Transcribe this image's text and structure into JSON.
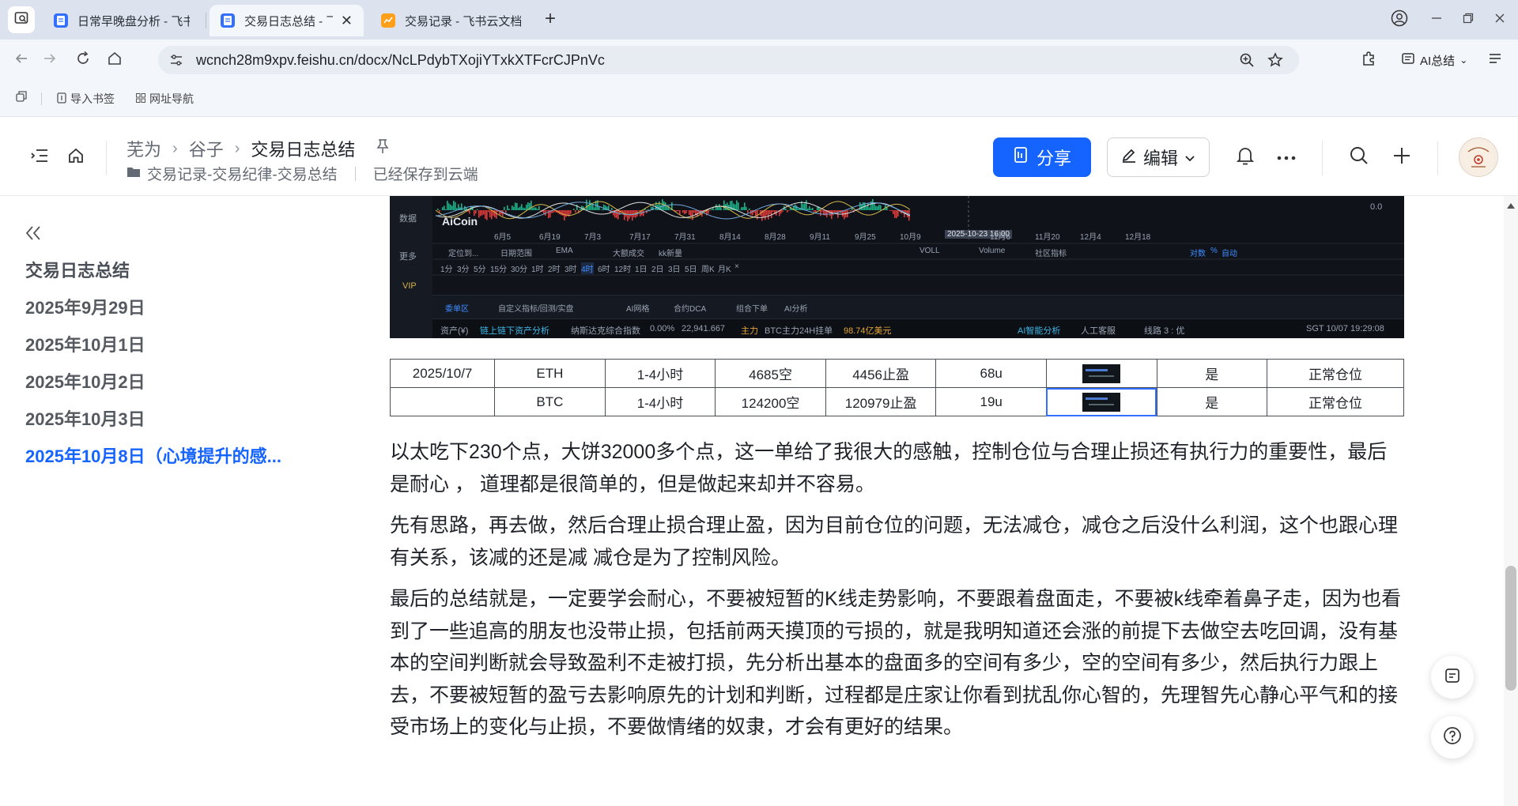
{
  "browser": {
    "tabs": [
      {
        "label": "日常早晚盘分析 - 飞书",
        "active": false
      },
      {
        "label": "交易日志总结 - 飞",
        "active": true
      },
      {
        "label": "交易记录 - 飞书云文档",
        "active": false
      }
    ],
    "url": "wcnch28m9xpv.feishu.cn/docx/NcLPdybTXojiYTxkXTFcrCJPnVc",
    "ai_label": "AI总结",
    "bookmarks": [
      "导入书签",
      "网址导航"
    ]
  },
  "header": {
    "breadcrumb": [
      "芜为",
      "谷子",
      "交易日志总结"
    ],
    "folder": "交易记录-交易纪律-交易总结",
    "save_status": "已经保存到云端",
    "share_label": "分享",
    "edit_label": "编辑"
  },
  "outline": {
    "items": [
      {
        "label": "交易日志总结",
        "active": false
      },
      {
        "label": "2025年9月29日",
        "active": false
      },
      {
        "label": "2025年10月1日",
        "active": false
      },
      {
        "label": "2025年10月2日",
        "active": false
      },
      {
        "label": "2025年10月3日",
        "active": false
      },
      {
        "label": "2025年10月8日（心境提升的感...",
        "active": true
      }
    ]
  },
  "chart_image": {
    "brand": "AiCoin",
    "x_ticks": [
      "6月5",
      "6月19",
      "7月3",
      "7月17",
      "7月31",
      "8月14",
      "8月28",
      "9月11",
      "9月25",
      "10月9",
      "2025-10-23 16:00",
      "11月6",
      "11月20",
      "12月4",
      "12月18"
    ],
    "toolbar": [
      "定位到...",
      "日期范围",
      "EMA",
      "大额成交",
      "kk新量",
      "VOLL",
      "Volume",
      "社区指标",
      "对数",
      "%",
      "自动"
    ],
    "intervals": [
      "1分",
      "3分",
      "5分",
      "15分",
      "30分",
      "1时",
      "2时",
      "3时",
      "4时",
      "6时",
      "12时",
      "1日",
      "2日",
      "3日",
      "5日",
      "周K",
      "月K",
      "×"
    ],
    "tabs": [
      "委单区",
      "自定义指标/回测/实盘",
      "AI网格",
      "合约DCA",
      "组合下单",
      "AI分析"
    ],
    "status": {
      "asset": "资产(¥)",
      "analysis": "链上链下资产分析",
      "nasdaq": "纳斯达克综合指数",
      "pct": "0.00%",
      "value": "22,941.667",
      "main": "主力",
      "btc_order": "BTC主力24H挂单",
      "btc_amount": "98.74亿美元",
      "ai": "AI智能分析",
      "service": "人工客服",
      "line": "线路 3 : 优",
      "time": "SGT 10/07 19:29:08"
    },
    "side_labels": [
      "数据",
      "更多",
      "VIP"
    ],
    "right_value": "0.0"
  },
  "trade_table": {
    "rows": [
      [
        "2025/10/7",
        "ETH",
        "1-4小时",
        "4685空",
        "4456止盈",
        "68u",
        "",
        "是",
        "正常仓位"
      ],
      [
        "",
        "BTC",
        "1-4小时",
        "124200空",
        "120979止盈",
        "19u",
        "",
        "是",
        "正常仓位"
      ]
    ]
  },
  "paragraphs": [
    "以太吃下230个点，大饼32000多个点，这一单给了我很大的感触，控制仓位与合理止损还有执行力的重要性，最后是耐心 ， 道理都是很简单的，但是做起来却并不容易。",
    "先有思路，再去做，然后合理止损合理止盈，因为目前仓位的问题，无法减仓，减仓之后没什么利润，这个也跟心理有关系，该减的还是减 减仓是为了控制风险。",
    "最后的总结就是，一定要学会耐心，不要被短暂的K线走势影响，不要跟着盘面走，不要被k线牵着鼻子走，因为也看到了一些追高的朋友也没带止损，包括前两天摸顶的亏损的，就是我明知道还会涨的前提下去做空去吃回调，没有基本的空间判断就会导致盈利不走被打损，先分析出基本的盘面多的空间有多少，空的空间有多少，然后执行力跟上去，不要被短暂的盈亏去影响原先的计划和判断，过程都是庄家让你看到扰乱你心智的，先理智先心静心平气和的接受市场上的变化与止损，不要做情绪的奴隶，才会有更好的结果。"
  ],
  "colors": {
    "accent": "#1664ff",
    "chart_up": "#18b58a",
    "chart_down": "#e33a3a"
  }
}
